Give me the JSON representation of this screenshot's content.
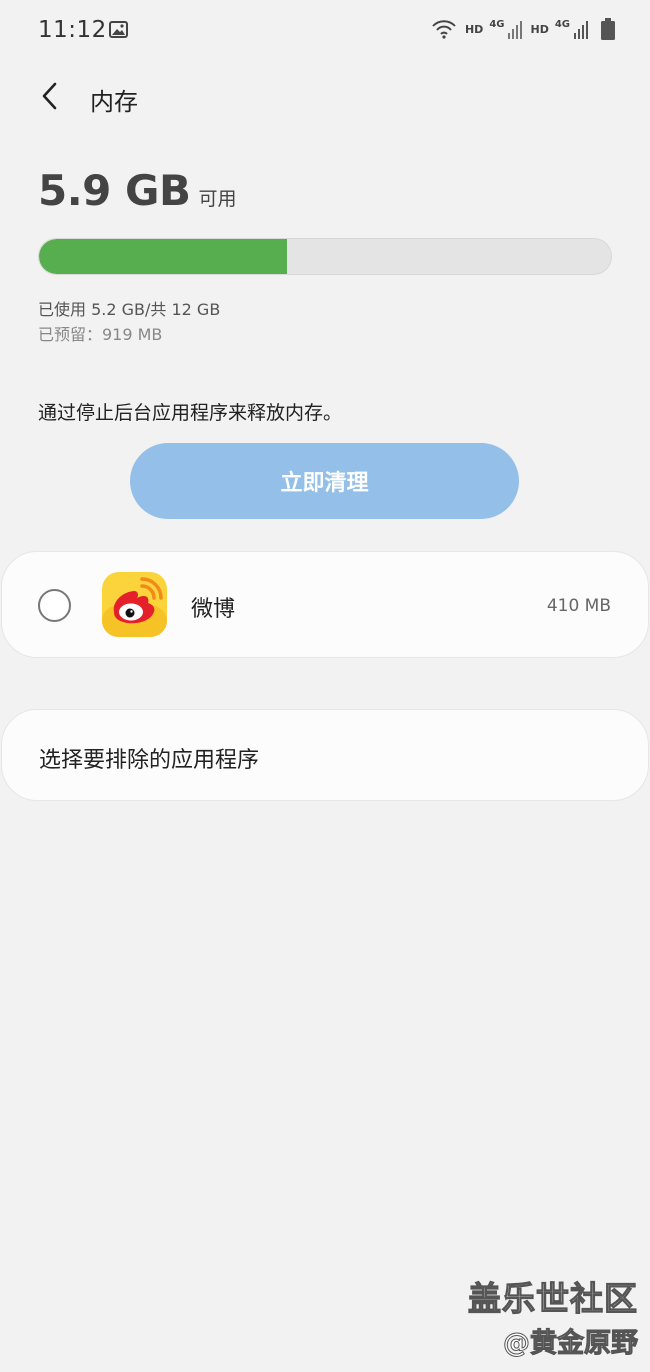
{
  "status_bar": {
    "time": "11:12",
    "hd_1": "HD",
    "net_1": "4G",
    "hd_2": "HD",
    "net_2": "4G",
    "icons": [
      "image-notification-icon",
      "wifi-icon",
      "signal-icon",
      "signal-icon",
      "battery-icon"
    ]
  },
  "header": {
    "title": "内存",
    "back_icon": "chevron-left-icon"
  },
  "memory": {
    "available_value": "5.9 GB",
    "available_label": "可用",
    "used_fraction": 0.433,
    "used_text": "已使用 5.2 GB/共 12 GB",
    "reserved_text": "已预留：919 MB",
    "bar_color": "#56ae4f",
    "track_color": "#e4e4e4"
  },
  "hint": "通过停止后台应用程序来释放内存。",
  "clean_button": {
    "label": "立即清理",
    "color": "#93bfe9"
  },
  "apps": [
    {
      "name": "微博",
      "size": "410 MB",
      "checked": false,
      "icon": "weibo-app-icon"
    }
  ],
  "exclude": {
    "label": "选择要排除的应用程序"
  },
  "watermark": {
    "line1": "盖乐世社区",
    "line2": "@黄金原野"
  }
}
